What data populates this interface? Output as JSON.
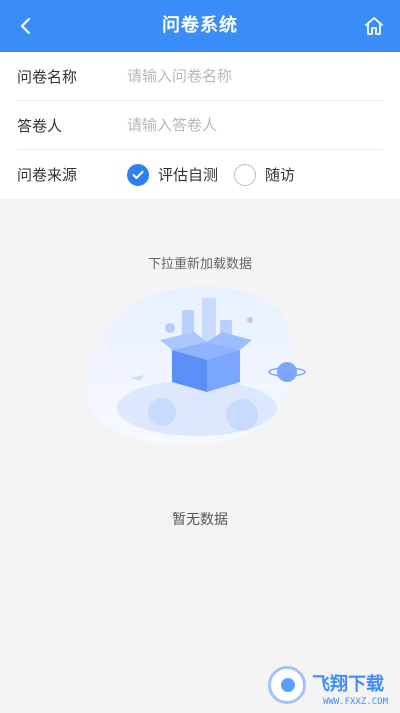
{
  "header": {
    "title": "问卷系统"
  },
  "form": {
    "name_label": "问卷名称",
    "name_placeholder": "请输入问卷名称",
    "respondent_label": "答卷人",
    "respondent_placeholder": "请输入答卷人",
    "source_label": "问卷来源",
    "source_options": [
      {
        "label": "评估自测",
        "checked": true
      },
      {
        "label": "随访",
        "checked": false
      }
    ]
  },
  "content": {
    "pull_hint": "下拉重新加载数据",
    "empty_text": "暂无数据"
  },
  "watermark": {
    "text": "飞翔下载",
    "url": "WWW.FXXZ.COM"
  },
  "colors": {
    "primary": "#3a8df6",
    "radio_checked": "#2f7ff0",
    "background": "#f4f4f4"
  }
}
